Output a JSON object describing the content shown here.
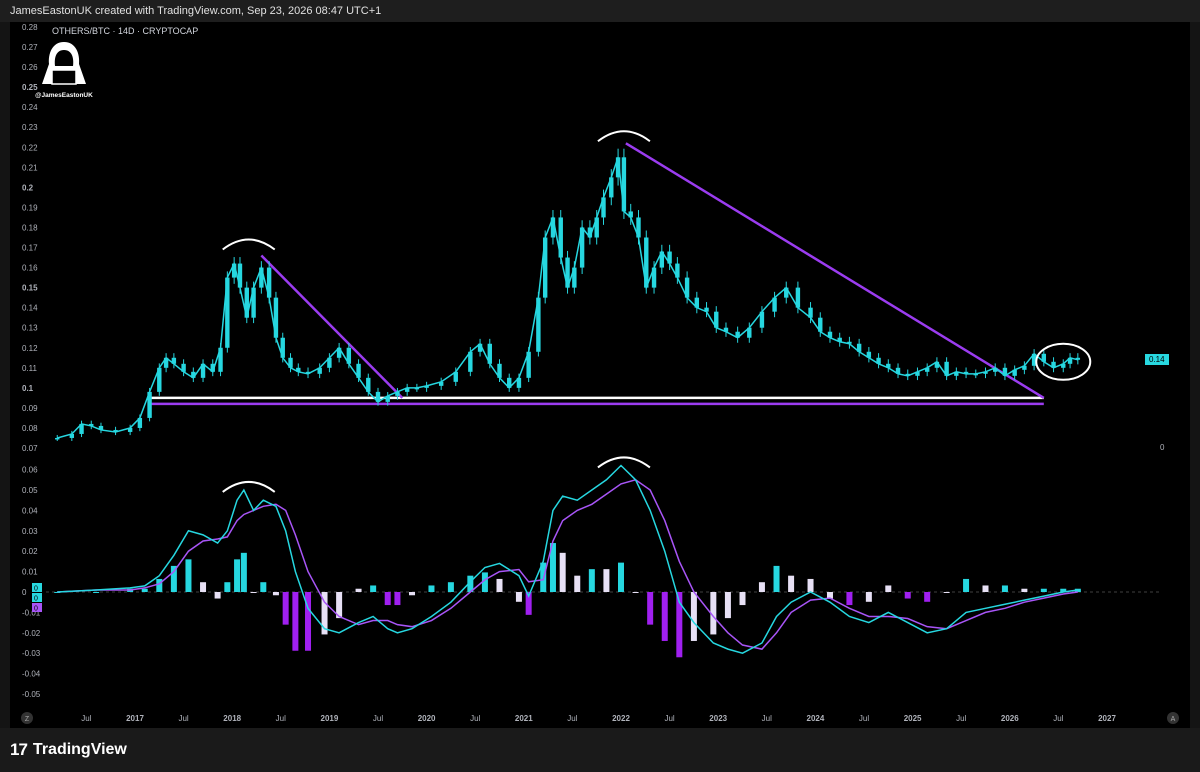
{
  "header": {
    "credit": "JamesEastonUK created with TradingView.com, Sep 23, 2026 08:47 UTC+1"
  },
  "symbol_title": "OTHERS/BTC · 14D · CRYPTOCAP",
  "watermark": {
    "handle": "@JamesEastonUK"
  },
  "price_label": "0.14",
  "oscillator_zero_label": "0",
  "corner_z": "Z",
  "corner_a": "A",
  "footer": {
    "brand_mark": "17",
    "brand_name": "TradingView"
  },
  "colors": {
    "candle": "#26d7e0",
    "trend": "#9b3cf0",
    "macd": "#26d7e0",
    "signal": "#a855f7",
    "hist_pos": "#26d7e0",
    "hist_neg": "#a020f0",
    "hist_fade": "#e7e0f5"
  },
  "chart_data": [
    {
      "type": "line",
      "title": "OTHERS/BTC · 14D · CRYPTOCAP",
      "price_axis_ticks": [
        "0.28",
        "0.27",
        "0.26",
        "0.25",
        "0.24",
        "0.23",
        "0.22",
        "0.21",
        "0.2",
        "0.19",
        "0.18",
        "0.17",
        "0.16",
        "0.15",
        "0.14",
        "0.13",
        "0.12",
        "0.11",
        "0.1",
        "0.09",
        "0.08",
        "0.07"
      ],
      "ylim": [
        0.07,
        0.28
      ],
      "time_axis_labels": [
        "Jul",
        "2017",
        "Jul",
        "2018",
        "Jul",
        "2019",
        "Jul",
        "2020",
        "Jul",
        "2021",
        "Jul",
        "2022",
        "Jul",
        "2023",
        "Jul",
        "2024",
        "Jul",
        "2025",
        "Jul",
        "2026",
        "Jul",
        "2027"
      ],
      "series": [
        {
          "x": [
            2016.2,
            2016.35,
            2016.45,
            2016.55,
            2016.65,
            2016.8,
            2016.95,
            2017.05,
            2017.15,
            2017.25,
            2017.32,
            2017.4,
            2017.5,
            2017.6,
            2017.7,
            2017.8,
            2017.88,
            2017.95,
            2018.02,
            2018.08,
            2018.15,
            2018.22,
            2018.3,
            2018.38,
            2018.45,
            2018.52,
            2018.6,
            2018.68,
            2018.78,
            2018.9,
            2019.0,
            2019.1,
            2019.2,
            2019.3,
            2019.4,
            2019.5,
            2019.6,
            2019.7,
            2019.8,
            2019.9,
            2020.0,
            2020.15,
            2020.3,
            2020.45,
            2020.55,
            2020.65,
            2020.75,
            2020.85,
            2020.95,
            2021.05,
            2021.15,
            2021.22,
            2021.3,
            2021.38,
            2021.45,
            2021.52,
            2021.6,
            2021.68,
            2021.75,
            2021.82,
            2021.9,
            2021.97,
            2022.03,
            2022.1,
            2022.18,
            2022.26,
            2022.34,
            2022.42,
            2022.5,
            2022.58,
            2022.68,
            2022.78,
            2022.88,
            2022.98,
            2023.08,
            2023.2,
            2023.32,
            2023.45,
            2023.58,
            2023.7,
            2023.82,
            2023.95,
            2024.05,
            2024.15,
            2024.25,
            2024.35,
            2024.45,
            2024.55,
            2024.65,
            2024.75,
            2024.85,
            2024.95,
            2025.05,
            2025.15,
            2025.25,
            2025.35,
            2025.45,
            2025.55,
            2025.65,
            2025.75,
            2025.85,
            2025.95,
            2026.05,
            2026.15,
            2026.25,
            2026.35,
            2026.45,
            2026.55,
            2026.62,
            2026.7
          ],
          "y": [
            0.075,
            0.077,
            0.082,
            0.081,
            0.079,
            0.078,
            0.08,
            0.085,
            0.098,
            0.11,
            0.115,
            0.112,
            0.108,
            0.105,
            0.112,
            0.108,
            0.12,
            0.155,
            0.162,
            0.15,
            0.135,
            0.15,
            0.16,
            0.145,
            0.125,
            0.115,
            0.11,
            0.108,
            0.107,
            0.11,
            0.115,
            0.12,
            0.112,
            0.105,
            0.098,
            0.093,
            0.096,
            0.098,
            0.1,
            0.1,
            0.101,
            0.103,
            0.108,
            0.118,
            0.122,
            0.112,
            0.105,
            0.1,
            0.105,
            0.118,
            0.145,
            0.175,
            0.185,
            0.165,
            0.15,
            0.16,
            0.18,
            0.175,
            0.185,
            0.195,
            0.205,
            0.215,
            0.188,
            0.185,
            0.175,
            0.15,
            0.16,
            0.168,
            0.162,
            0.155,
            0.145,
            0.14,
            0.138,
            0.13,
            0.128,
            0.125,
            0.13,
            0.138,
            0.145,
            0.15,
            0.14,
            0.135,
            0.128,
            0.125,
            0.123,
            0.122,
            0.118,
            0.115,
            0.112,
            0.11,
            0.107,
            0.106,
            0.108,
            0.11,
            0.113,
            0.106,
            0.108,
            0.107,
            0.107,
            0.108,
            0.11,
            0.106,
            0.109,
            0.111,
            0.117,
            0.113,
            0.11,
            0.112,
            0.115,
            0.114
          ]
        }
      ],
      "trendlines": [
        {
          "name": "support-2017-2026",
          "x": [
            2017.15,
            2026.35
          ],
          "y": [
            0.095,
            0.095
          ],
          "color": "#ffffff"
        },
        {
          "name": "support-lower",
          "x": [
            2017.15,
            2026.35
          ],
          "y": [
            0.092,
            0.092
          ],
          "color": "#9b3cf0"
        },
        {
          "name": "descending-2018",
          "x": [
            2018.3,
            2019.75
          ],
          "y": [
            0.166,
            0.095
          ],
          "color": "#9b3cf0"
        },
        {
          "name": "descending-2022",
          "x": [
            2022.05,
            2026.35
          ],
          "y": [
            0.222,
            0.095
          ],
          "color": "#9b3cf0"
        }
      ],
      "markers": [
        {
          "kind": "arc",
          "x": 2018.17,
          "y": 0.172
        },
        {
          "kind": "arc",
          "x": 2022.03,
          "y": 0.226
        },
        {
          "kind": "ellipse",
          "x": 2026.55,
          "y": 0.113
        }
      ]
    },
    {
      "type": "line",
      "name_hidden": true,
      "osc_axis_ticks": [
        "0.06",
        "0.05",
        "0.04",
        "0.03",
        "0.02",
        "0.01",
        "0",
        "-0.01",
        "-0.02",
        "-0.03",
        "-0.04",
        "-0.05"
      ],
      "ylim": [
        -0.05,
        0.06
      ],
      "macd_x": [
        2016.2,
        2016.6,
        2016.95,
        2017.1,
        2017.25,
        2017.4,
        2017.55,
        2017.7,
        2017.85,
        2017.95,
        2018.05,
        2018.12,
        2018.22,
        2018.32,
        2018.45,
        2018.55,
        2018.65,
        2018.78,
        2018.95,
        2019.1,
        2019.3,
        2019.45,
        2019.6,
        2019.7,
        2019.85,
        2020.05,
        2020.25,
        2020.45,
        2020.6,
        2020.75,
        2020.95,
        2021.05,
        2021.2,
        2021.3,
        2021.4,
        2021.55,
        2021.7,
        2021.85,
        2022.0,
        2022.15,
        2022.3,
        2022.45,
        2022.6,
        2022.75,
        2022.95,
        2023.1,
        2023.25,
        2023.45,
        2023.6,
        2023.75,
        2023.95,
        2024.15,
        2024.35,
        2024.55,
        2024.75,
        2024.95,
        2025.15,
        2025.35,
        2025.55,
        2025.75,
        2025.95,
        2026.15,
        2026.35,
        2026.55,
        2026.7
      ],
      "macd_y": [
        0.0,
        0.001,
        0.002,
        0.003,
        0.008,
        0.018,
        0.03,
        0.028,
        0.024,
        0.03,
        0.045,
        0.05,
        0.04,
        0.045,
        0.042,
        0.03,
        0.01,
        -0.008,
        -0.018,
        -0.02,
        -0.015,
        -0.012,
        -0.018,
        -0.02,
        -0.018,
        -0.012,
        -0.005,
        0.005,
        0.012,
        0.014,
        0.008,
        -0.002,
        0.015,
        0.04,
        0.047,
        0.045,
        0.05,
        0.055,
        0.062,
        0.055,
        0.04,
        0.02,
        -0.005,
        -0.015,
        -0.025,
        -0.028,
        -0.03,
        -0.025,
        -0.012,
        -0.005,
        0.0,
        -0.005,
        -0.012,
        -0.015,
        -0.01,
        -0.015,
        -0.02,
        -0.018,
        -0.01,
        -0.008,
        -0.006,
        -0.004,
        -0.002,
        0.0,
        0.001
      ],
      "signal_y": [
        0.0,
        0.001,
        0.001,
        0.002,
        0.004,
        0.01,
        0.02,
        0.025,
        0.026,
        0.027,
        0.035,
        0.038,
        0.04,
        0.042,
        0.043,
        0.04,
        0.028,
        0.01,
        -0.005,
        -0.012,
        -0.016,
        -0.014,
        -0.014,
        -0.016,
        -0.017,
        -0.014,
        -0.008,
        0.0,
        0.006,
        0.01,
        0.011,
        0.005,
        0.006,
        0.025,
        0.035,
        0.04,
        0.043,
        0.048,
        0.053,
        0.055,
        0.05,
        0.035,
        0.015,
        0.0,
        -0.012,
        -0.02,
        -0.026,
        -0.028,
        -0.02,
        -0.01,
        -0.004,
        -0.003,
        -0.008,
        -0.012,
        -0.012,
        -0.013,
        -0.017,
        -0.018,
        -0.014,
        -0.01,
        -0.008,
        -0.005,
        -0.003,
        -0.001,
        0.0
      ],
      "markers": [
        {
          "kind": "arc",
          "x": 2018.17,
          "y": 0.052
        },
        {
          "kind": "arc",
          "x": 2022.03,
          "y": 0.064
        }
      ]
    }
  ]
}
